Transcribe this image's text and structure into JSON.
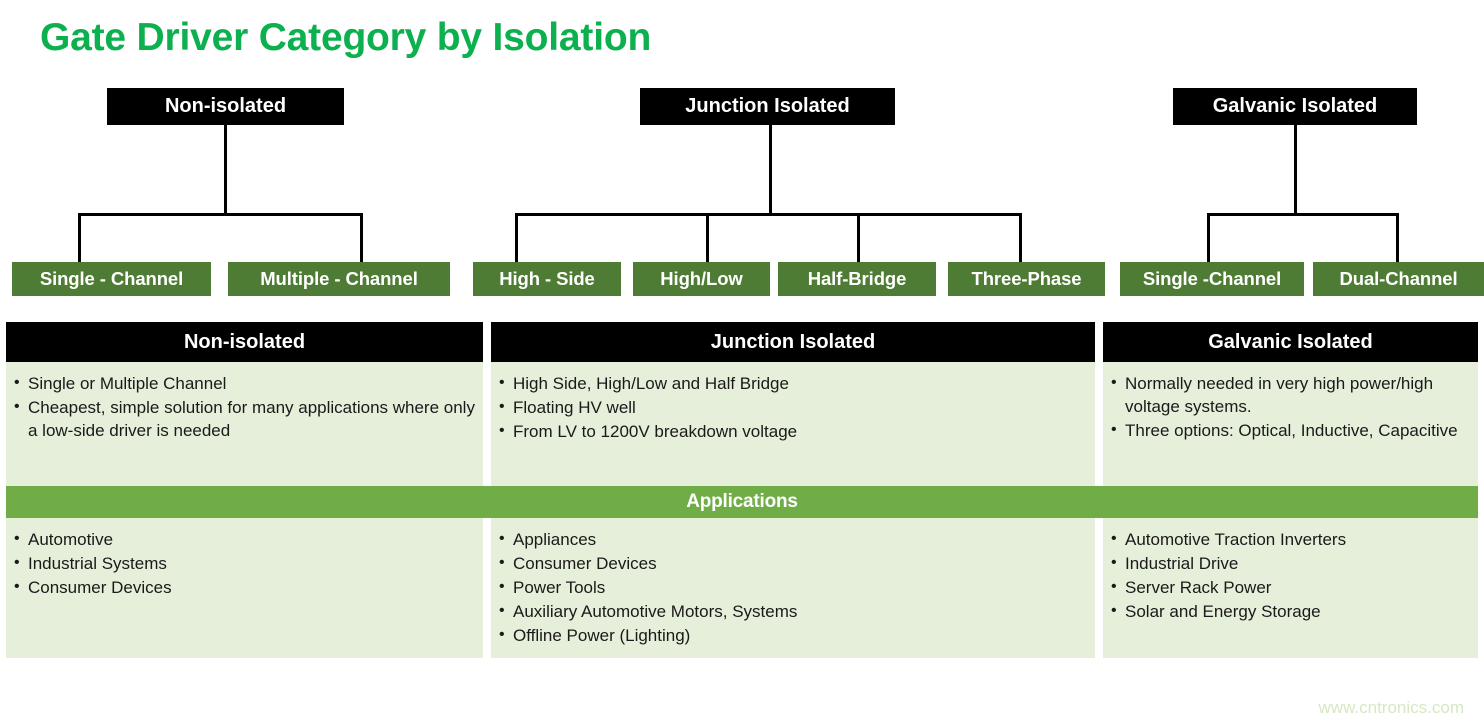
{
  "page": {
    "title": "Gate Driver Category by Isolation",
    "watermark": "www.cntronics.com",
    "title_color": "#0cb04e",
    "leaf_box_color": "#4f7c34",
    "applications_bar_color": "#70ad47",
    "cell_background_color": "#e5efd9",
    "header_color": "#000000"
  },
  "tree": {
    "branches": [
      {
        "header": "Non-isolated",
        "leaves": [
          "Single - Channel",
          "Multiple - Channel"
        ]
      },
      {
        "header": "Junction Isolated",
        "leaves": [
          "High - Side",
          "High/Low",
          "Half-Bridge",
          "Three-Phase"
        ]
      },
      {
        "header": "Galvanic Isolated",
        "leaves": [
          "Single -Channel",
          "Dual-Channel"
        ]
      }
    ]
  },
  "table": {
    "headers": [
      "Non-isolated",
      "Junction Isolated",
      "Galvanic Isolated"
    ],
    "description_row": [
      [
        "Single or Multiple Channel",
        "Cheapest, simple solution for many applications where only a low-side driver is needed"
      ],
      [
        "High Side, High/Low and Half Bridge",
        "Floating HV well",
        "From LV to 1200V breakdown voltage"
      ],
      [
        "Normally needed in very high power/high voltage systems.",
        "Three options: Optical, Inductive, Capacitive"
      ]
    ],
    "applications_label": "Applications",
    "applications_row": [
      [
        "Automotive",
        "Industrial Systems",
        "Consumer Devices"
      ],
      [
        "Appliances",
        "Consumer Devices",
        "Power Tools",
        "Auxiliary Automotive Motors, Systems",
        "Offline Power (Lighting)"
      ],
      [
        "Automotive Traction Inverters",
        "Industrial Drive",
        "Server Rack Power",
        "Solar and Energy Storage"
      ]
    ]
  }
}
